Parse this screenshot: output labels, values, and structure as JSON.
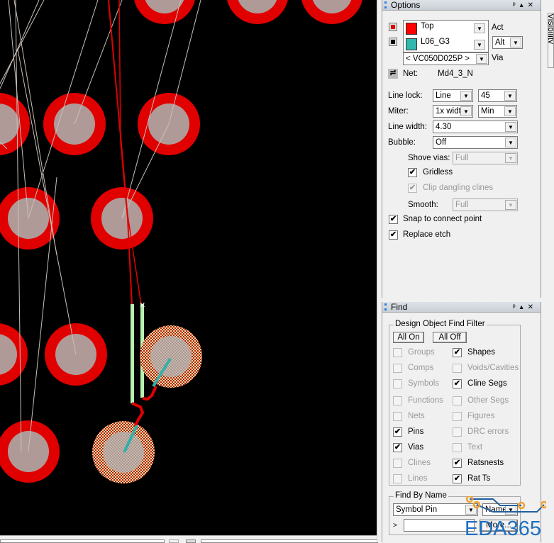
{
  "options": {
    "title": "Options",
    "active_layer": "Top",
    "active_label": "Act",
    "alt_layer": "L06_G3",
    "alt_value": "Alt",
    "via": "< VC050D025P >",
    "via_label": "Via",
    "net_label": "Net:",
    "net_value": "Md4_3_N",
    "line_lock_label": "Line lock:",
    "line_lock_value": "Line",
    "line_lock_angle": "45",
    "miter_label": "Miter:",
    "miter_value": "1x widt",
    "miter_min": "Min",
    "line_width_label": "Line width:",
    "line_width_value": "4.30",
    "bubble_label": "Bubble:",
    "bubble_value": "Off",
    "shove_vias_label": "Shove vias:",
    "shove_vias_value": "Full",
    "gridless_label": "Gridless",
    "gridless_checked": true,
    "clip_label": "Clip dangling clines",
    "clip_checked": true,
    "smooth_label": "Smooth:",
    "smooth_value": "Full",
    "snap_label": "Snap to connect point",
    "snap_checked": true,
    "replace_label": "Replace etch",
    "replace_checked": true,
    "colors": {
      "top": "#ff0000",
      "alt": "#33b8b0"
    }
  },
  "visibility_tab": "Visibility",
  "find": {
    "title": "Find",
    "filter_title": "Design Object Find Filter",
    "all_on": "All On",
    "all_off": "All Off",
    "left": [
      {
        "label": "Groups",
        "checked": false,
        "enabled": false
      },
      {
        "label": "Comps",
        "checked": false,
        "enabled": false
      },
      {
        "label": "Symbols",
        "checked": false,
        "enabled": false
      },
      {
        "label": "Functions",
        "checked": false,
        "enabled": false
      },
      {
        "label": "Nets",
        "checked": false,
        "enabled": false
      },
      {
        "label": "Pins",
        "checked": true,
        "enabled": true
      },
      {
        "label": "Vias",
        "checked": true,
        "enabled": true
      },
      {
        "label": "Clines",
        "checked": false,
        "enabled": false
      },
      {
        "label": "Lines",
        "checked": false,
        "enabled": false
      }
    ],
    "right": [
      {
        "label": "Shapes",
        "checked": true,
        "enabled": true
      },
      {
        "label": "Voids/Cavities",
        "checked": false,
        "enabled": false
      },
      {
        "label": "Cline Segs",
        "checked": true,
        "enabled": true
      },
      {
        "label": "Other Segs",
        "checked": false,
        "enabled": false
      },
      {
        "label": "Figures",
        "checked": false,
        "enabled": false
      },
      {
        "label": "DRC errors",
        "checked": false,
        "enabled": false
      },
      {
        "label": "Text",
        "checked": false,
        "enabled": false
      },
      {
        "label": "Ratsnests",
        "checked": true,
        "enabled": true
      },
      {
        "label": "Rat Ts",
        "checked": true,
        "enabled": true
      }
    ],
    "by_name_title": "Find By Name",
    "by_name_type": "Symbol Pin",
    "by_name_mode": "Name",
    "prompt": ">",
    "name_input": "",
    "more_button": "More..."
  },
  "watermark": "EDA365"
}
